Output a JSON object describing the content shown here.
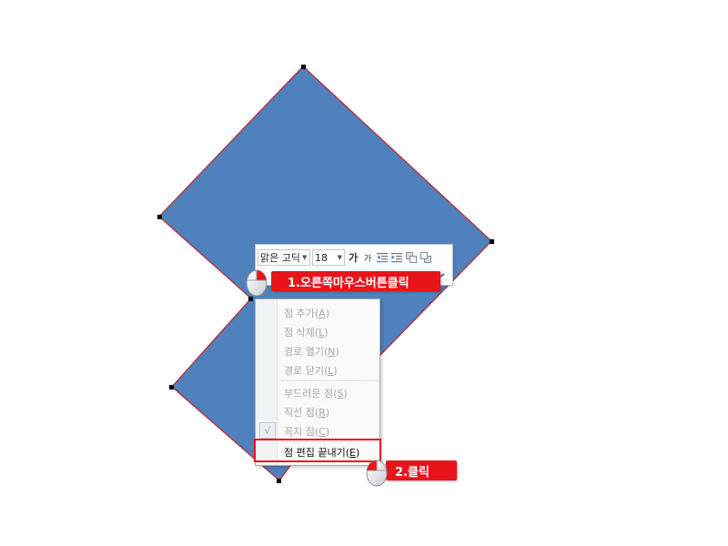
{
  "toolbar": {
    "font_name": "맑은 고딕",
    "font_size": "18",
    "grow_font_glyph": "가",
    "shrink_font_glyph": "가"
  },
  "callouts": {
    "step1": "1.오른쪽마우스버튼클릭",
    "step2": "2.클릭"
  },
  "context_menu": {
    "items": [
      {
        "text": "점 추가",
        "key": "A",
        "enabled": false
      },
      {
        "text": "점 삭제",
        "key": "L",
        "enabled": false
      },
      {
        "text": "경로 열기",
        "key": "N",
        "enabled": false
      },
      {
        "text": "경로 닫기",
        "key": "L",
        "enabled": false
      },
      {
        "text": "부드러운 점",
        "key": "S",
        "enabled": false
      },
      {
        "text": "직선 점",
        "key": "R",
        "enabled": false
      },
      {
        "text": "꼭지 점",
        "key": "C",
        "enabled": false,
        "checked": true
      },
      {
        "text": "점 편집 끝내기",
        "key": "E",
        "enabled": true
      }
    ],
    "check_glyph": "√"
  },
  "colors": {
    "shape_fill": "#4f81bd",
    "shape_outline": "#c0392b",
    "callout_red": "#e8141a"
  },
  "icons": {
    "mouse": "mouse-right-click-icon"
  }
}
